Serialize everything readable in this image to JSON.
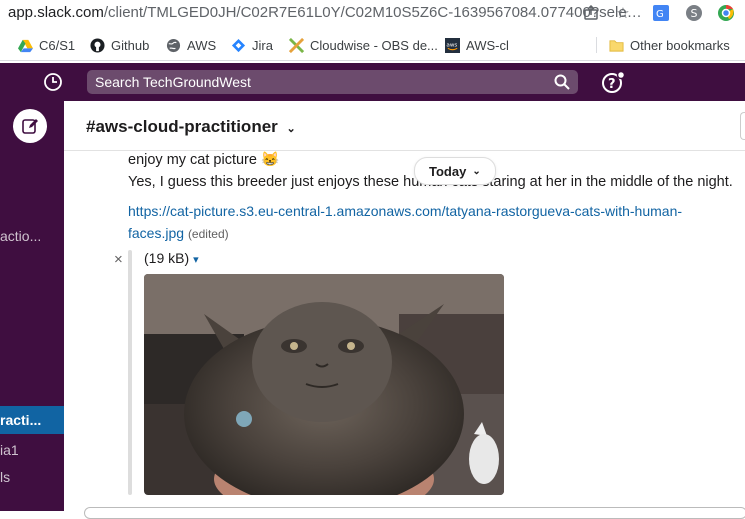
{
  "browser": {
    "url_host": "app.slack.com",
    "url_path": "/client/TMLGED0JH/C02R7E61L0Y/C02M10S5Z6C-1639567084.077400?sele…",
    "bookmarks": [
      {
        "label": "C6/S1"
      },
      {
        "label": "Github"
      },
      {
        "label": "AWS"
      },
      {
        "label": "Jira"
      },
      {
        "label": "Cloudwise - OBS de..."
      },
      {
        "label": "AWS-cl"
      }
    ],
    "other_bookmarks": "Other bookmarks"
  },
  "slack": {
    "search_placeholder": "Search TechGroundWest",
    "channel": {
      "hash": "#",
      "name": "aws-cloud-practitioner"
    },
    "sidebar": {
      "items": [
        {
          "label": "actio..."
        },
        {
          "label": "racti..."
        },
        {
          "label": "ia1"
        },
        {
          "label": "ls"
        }
      ]
    },
    "date_divider": "Today",
    "messages": {
      "line1": "enjoy my cat picture",
      "line1_emoji": "😸",
      "line2": "Yes, I guess this breeder just enjoys these human cats staring at her in the middle of the night.",
      "link_line1": "https://cat-picture.s3.eu-central-1.amazonaws.com/tatyana-rastorgueva-cats-with-human-",
      "link_line2": "faces.jpg",
      "edited": "(edited)"
    },
    "attachment": {
      "size": "(19 kB)",
      "close": "×"
    }
  },
  "colors": {
    "slack_aubergine": "#3f0e40",
    "active_blue": "#1164a3",
    "link_blue": "#1264a3"
  }
}
